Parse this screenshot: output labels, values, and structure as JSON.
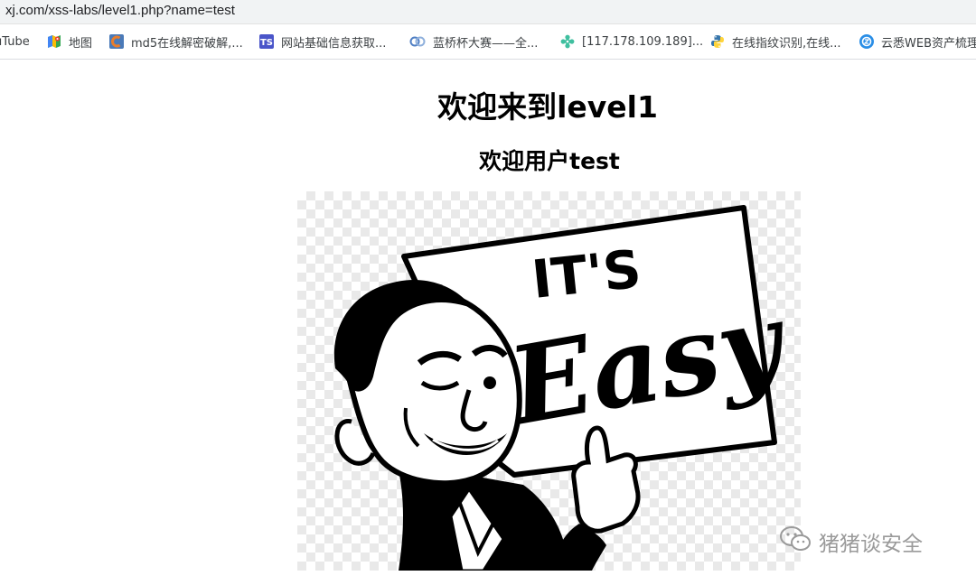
{
  "browser": {
    "url": "xj.com/xss-labs/level1.php?name=test"
  },
  "bookmarks": [
    {
      "label": "uTube",
      "icon": "youtube-icon"
    },
    {
      "label": "地图",
      "icon": "maps-icon"
    },
    {
      "label": "md5在线解密破解,...",
      "icon": "cmd5-icon"
    },
    {
      "label": "网站基础信息获取...",
      "icon": "ts-icon"
    },
    {
      "label": "蓝桥杯大赛——全...",
      "icon": "lanqiao-icon"
    },
    {
      "label": "[117.178.109.189]...",
      "icon": "gear-icon"
    },
    {
      "label": "在线指纹识别,在线...",
      "icon": "python-icon"
    },
    {
      "label": "云悉WEB资产梳理",
      "icon": "yunxi-icon"
    }
  ],
  "page": {
    "heading": "欢迎来到level1",
    "subheading": "欢迎用户test"
  },
  "image": {
    "sign_line1": "IT'S",
    "sign_line2": "Easy"
  },
  "watermark": {
    "text": "猪猪谈安全"
  }
}
